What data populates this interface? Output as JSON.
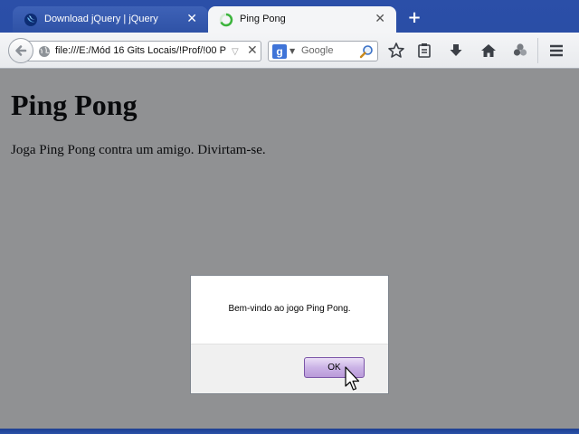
{
  "tabs": [
    {
      "title": "Download jQuery | jQuery",
      "close": "✕",
      "favicon": "jquery-icon",
      "active": false
    },
    {
      "title": "Ping Pong",
      "close": "✕",
      "favicon": "loading-spinner-icon",
      "active": true
    }
  ],
  "new_tab_label": "+",
  "toolbar": {
    "url": "file:///E:/Mód 16 Gits Locais/!Prof/!00 P",
    "dropmarker": "▽",
    "stop": "✕",
    "search_engine_letter": "g",
    "search_engine_drop": "▼",
    "search_placeholder": "Google"
  },
  "page": {
    "heading": "Ping Pong",
    "text": "Joga Ping Pong contra um amigo. Divirtam-se."
  },
  "dialog": {
    "message": "Bem-vindo ao jogo Ping Pong.",
    "ok_label": "OK"
  },
  "colors": {
    "overlay": "#8a8c90",
    "ok_button": "#c4a9e2",
    "frame": "#2b4fa8"
  }
}
